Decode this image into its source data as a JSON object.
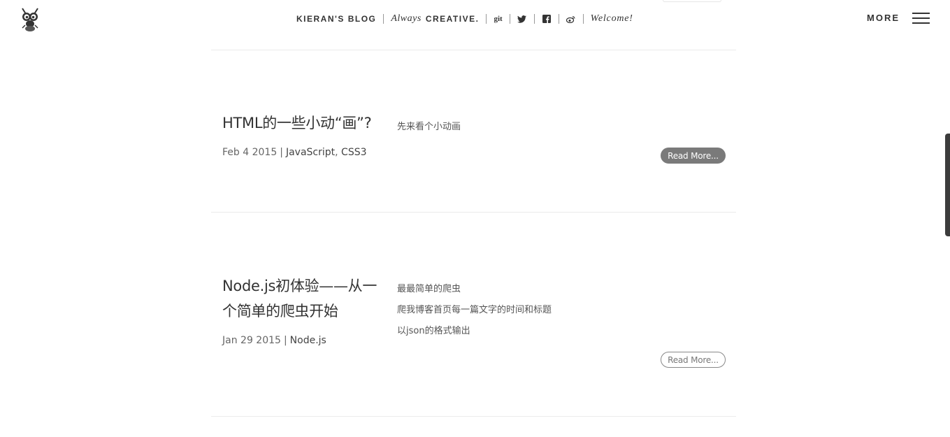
{
  "header": {
    "brand": "KIERAN'S BLOG",
    "tagline_italic": "Always",
    "tagline_caps": "CREATIVE.",
    "git_label": "git",
    "social_icons": [
      "twitter-icon",
      "facebook-icon",
      "weibo-icon"
    ],
    "welcome": "Welcome!",
    "more_label": "MORE"
  },
  "posts": [
    {
      "title_line1": "HTML的一些小动“画”?",
      "title_line2": "",
      "date": "Feb 4 2015",
      "tags": [
        "JavaScript",
        "CSS3"
      ],
      "excerpt": [
        "先来看个小动画"
      ],
      "read_more": "Read More...",
      "read_more_style": "filled"
    },
    {
      "title_line1": "Node.js初体验——从一",
      "title_line2": "个简单的爬虫开始",
      "date": "Jan 29 2015",
      "tags": [
        "Node.js"
      ],
      "excerpt": [
        "最最简单的爬虫",
        "爬我博客首页每一篇文字的时间和标题",
        "以json的格式输出"
      ],
      "read_more": "Read More...",
      "read_more_style": "outline"
    }
  ],
  "colors": {
    "text": "#333333",
    "button_filled": "#7a7a7a",
    "divider": "#ebebeb"
  }
}
